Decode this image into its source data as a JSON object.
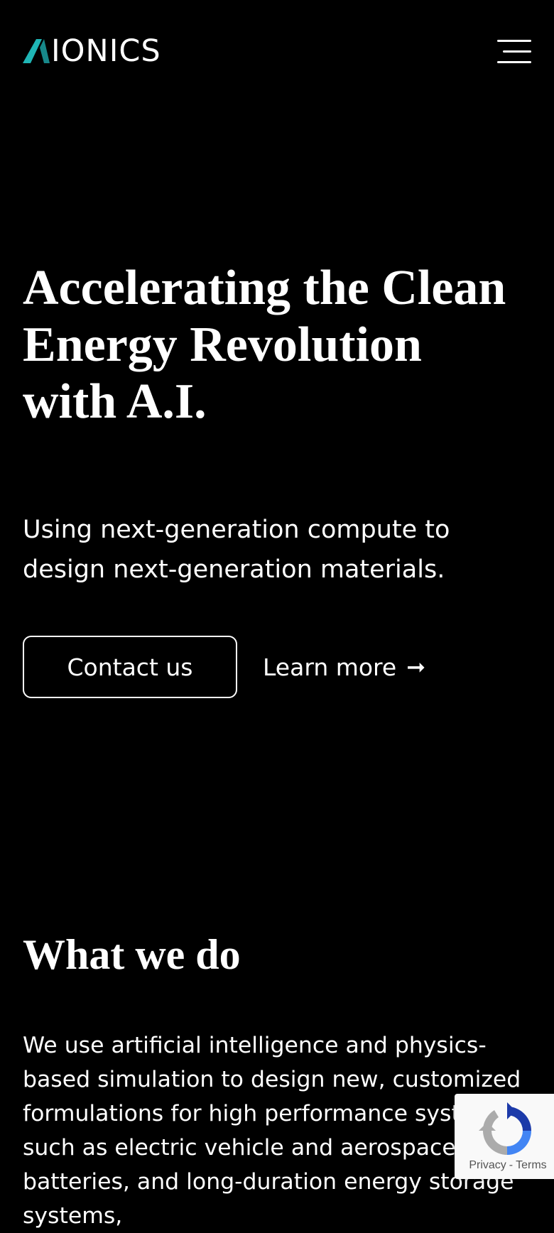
{
  "header": {
    "logo_text": "IONICS",
    "logo_full": "AIONICS",
    "logo_accent": "#1fb5b5",
    "menu_icon": "hamburger-menu-icon"
  },
  "hero": {
    "title": "Accelerating the Clean Energy Revolution with A.I.",
    "subtitle": "Using next-generation compute to design next-generation materials.",
    "contact_label": "Contact us",
    "learn_more_label": "Learn more",
    "learn_more_icon": "arrow-right-icon"
  },
  "what_we_do": {
    "title": "What we do",
    "body": "We use artificial intelligence and physics-based simulation to design new, customized formulations for high performance systems such as electric vehicle and aerospace batteries, and long-duration energy storage systems,"
  },
  "recaptcha": {
    "icon": "recaptcha-icon",
    "privacy_label": "Privacy",
    "separator": "-",
    "terms_label": "Terms"
  },
  "colors": {
    "background": "#000000",
    "text": "#ffffff",
    "accent": "#1fb5b5"
  }
}
